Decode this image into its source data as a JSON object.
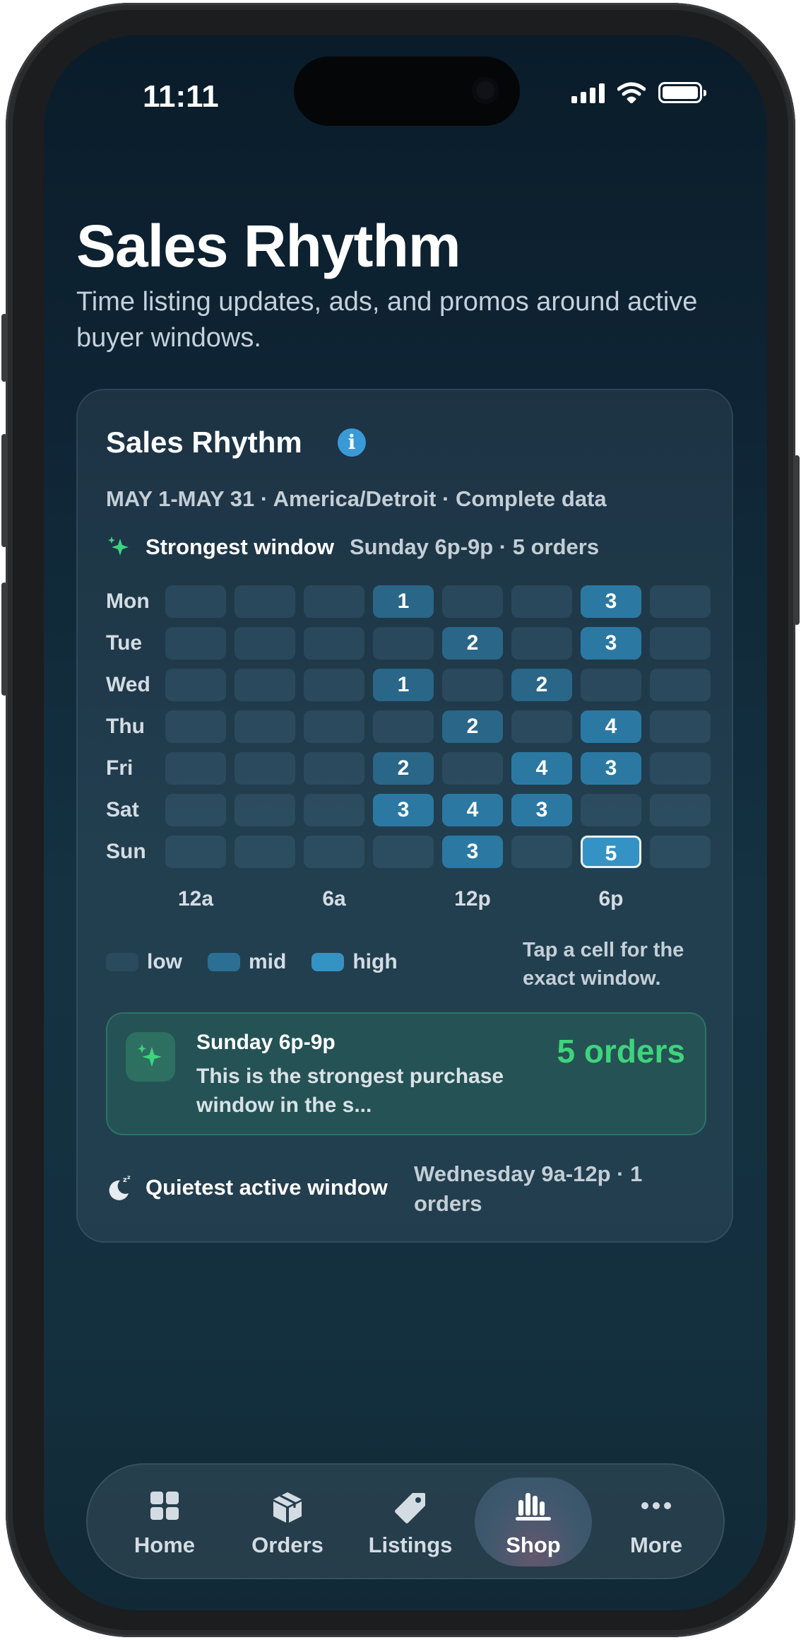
{
  "status_bar": {
    "time": "11:11"
  },
  "header": {
    "title": "Sales Rhythm",
    "subtitle": "Time listing updates, ads, and promos around active buyer windows."
  },
  "card": {
    "title": "Sales Rhythm",
    "info_icon": "info-icon",
    "range_line": "MAY 1-MAY 31 · America/Detroit · Complete data",
    "strongest_label": "Strongest window",
    "strongest_value": "Sunday 6p-9p · 5 orders",
    "heatmap": {
      "days": [
        "Mon",
        "Tue",
        "Wed",
        "Thu",
        "Fri",
        "Sat",
        "Sun"
      ],
      "axis_labels": [
        "12a",
        "6a",
        "12p",
        "6p"
      ],
      "values": [
        [
          0,
          0,
          0,
          1,
          0,
          0,
          3,
          0
        ],
        [
          0,
          0,
          0,
          0,
          2,
          0,
          3,
          0
        ],
        [
          0,
          0,
          0,
          1,
          0,
          2,
          0,
          0
        ],
        [
          0,
          0,
          0,
          0,
          2,
          0,
          4,
          0
        ],
        [
          0,
          0,
          0,
          2,
          0,
          4,
          3,
          0
        ],
        [
          0,
          0,
          0,
          3,
          4,
          3,
          0,
          0
        ],
        [
          0,
          0,
          0,
          0,
          3,
          0,
          5,
          0
        ]
      ],
      "selected": {
        "day": "Sun",
        "slot": 6
      }
    },
    "legend": {
      "low": "low",
      "mid": "mid",
      "high": "high"
    },
    "tap_hint": "Tap a cell for the exact window.",
    "insight": {
      "title": "Sunday 6p-9p",
      "body": "This is the strongest purchase window in the s...",
      "count": "5 orders"
    },
    "quietest_label": "Quietest active window",
    "quietest_value": "Wednesday 9a-12p · 1 orders"
  },
  "tabbar": {
    "tabs": [
      {
        "label": "Home",
        "icon": "grid-icon"
      },
      {
        "label": "Orders",
        "icon": "box-icon"
      },
      {
        "label": "Listings",
        "icon": "tag-icon"
      },
      {
        "label": "Shop",
        "icon": "chart-icon",
        "active": true
      },
      {
        "label": "More",
        "icon": "ellipsis-icon"
      }
    ]
  },
  "colors": {
    "low": "#2a4a5e",
    "mid": "#2b79a3",
    "high": "#3592c4",
    "accent_green": "#3ed47c",
    "info_blue": "#3a9ad8"
  }
}
